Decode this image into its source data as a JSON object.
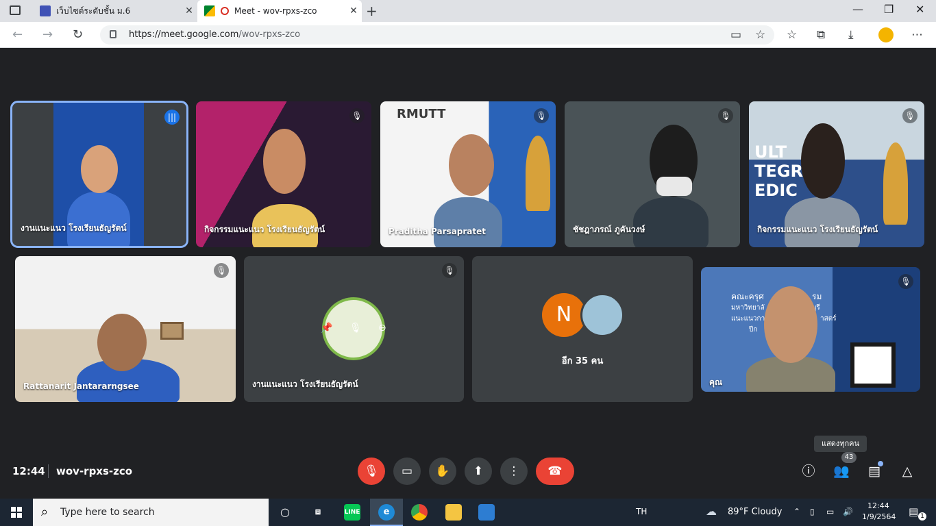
{
  "browser": {
    "tabs": [
      {
        "title": "เว็บไซต์ระดับชั้น ม.6",
        "active": false
      },
      {
        "title": "Meet - wov-rpxs-zco",
        "active": true
      }
    ],
    "new_tab": "+",
    "url_host": "https://meet.google.com",
    "url_path": "/wov-rpxs-zco",
    "window_controls": {
      "minimize": "—",
      "restore": "❐",
      "close": "✕"
    }
  },
  "tiles_top": [
    {
      "name": "งานแนะแนว โรงเรียนธัญรัตน์",
      "mic": "speaking"
    },
    {
      "name": "กิจกรรมแนะแนว โรงเรียนธัญรัตน์",
      "mic": "muted"
    },
    {
      "name": "Praditha Parsapratet",
      "mic": "muted"
    },
    {
      "name": "ชัชฎาภรณ์ ภูคันวงษ์",
      "mic": "muted"
    },
    {
      "name": "กิจกรรมแนะแนว โรงเรียนธัญรัตน์",
      "mic": "muted"
    }
  ],
  "tiles_bottom": [
    {
      "name": "Rattanarit Jantararngsee",
      "mic": "muted"
    },
    {
      "name": "งานแนะแนว โรงเรียนธัญรัตน์",
      "mic": "muted"
    },
    {
      "name": "อีก 35 คน",
      "avatar_letter": "N"
    },
    {
      "name": "คุณ",
      "mic": "muted"
    }
  ],
  "overlay_texts": {
    "rmutt": "RMUTT",
    "caption_faculty": "คณะครุศ",
    "caption_rm": "รม",
    "caption_uni": "มหาวิทยาลั",
    "caption_buri": "บุรี",
    "caption_guidance": "แนะแนวการ",
    "caption_sat": "าสตร์",
    "caption_pi": "ปีก",
    "banner_ult": "ULT",
    "banner_tegr": "TEGR",
    "banner_edic": "EDIC"
  },
  "bottom_bar": {
    "time": "12:44",
    "meeting_code": "wov-rpxs-zco",
    "tooltip": "แสดงทุกคน",
    "participant_count": "43"
  },
  "taskbar": {
    "search_placeholder": "Type here to search",
    "lang": "TH",
    "weather": "89°F  Cloudy",
    "clock_time": "12:44",
    "clock_date": "1/9/2564",
    "notifications": "1"
  },
  "colors": {
    "meet_bg": "#202124",
    "tile_bg": "#3c4043",
    "speaking_outline": "#8ab4f8",
    "hangup_red": "#ea4335",
    "avatar_orange": "#e8710a"
  }
}
